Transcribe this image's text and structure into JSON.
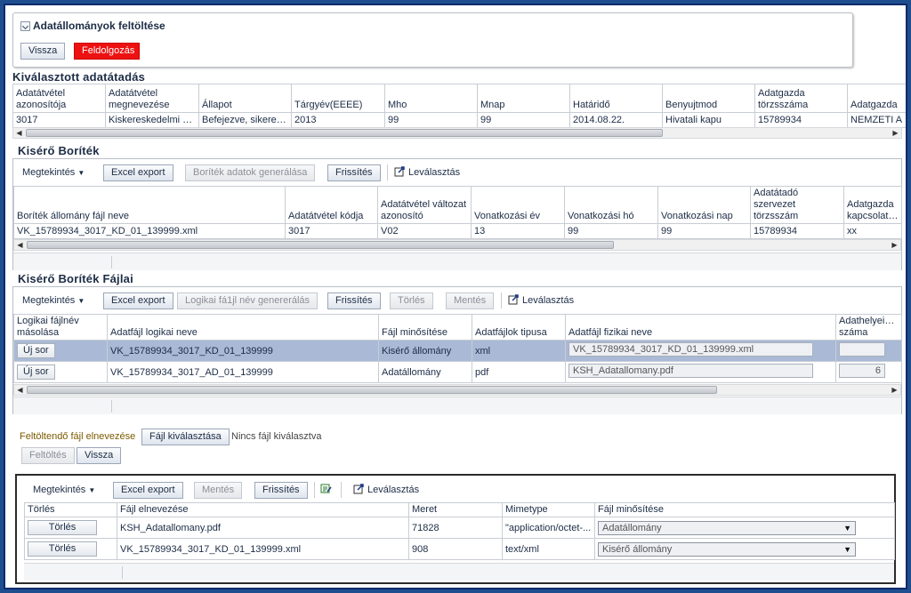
{
  "top": {
    "title": "Adatállományok feltöltése",
    "back_label": "Vissza",
    "process_label": "Feldolgozás"
  },
  "selected": {
    "title": "Kiválasztott adatátadás",
    "columns": [
      "Adatátvétel azonosítója",
      "Adatátvétel megnevezése",
      "Állapot",
      "Tárgyév(EEEE)",
      "Mho",
      "Mnap",
      "Határidő",
      "Benyujtmod",
      "Adatgazda törzsszáma",
      "Adatgazda"
    ],
    "rows": [
      [
        "3017",
        "Kiskereskedelmi e...",
        "Befejezve, sikeresen",
        "2013",
        "99",
        "99",
        "2014.08.22.",
        "Hivatali kapu",
        "15789934",
        "NEMZETI A"
      ]
    ]
  },
  "envelope": {
    "title": "Kisérő Boríték",
    "toolbar": {
      "view": "Megtekintés",
      "excel": "Excel export",
      "generate": "Boríték adatok generálása",
      "refresh": "Frissítés",
      "detach": "Leválasztás"
    },
    "columns": [
      "Boríték állomány fájl neve",
      "Adatátvétel kódja",
      "Adatátvétel változat azonosító",
      "Vonatkozási év",
      "Vonatkozási hó",
      "Vonatkozási nap",
      "Adatátadó szervezet törzsszám",
      "Adatgazda kapcsolattart"
    ],
    "rows": [
      [
        "VK_15789934_3017_KD_01_139999.xml",
        "3017",
        "V02",
        "13",
        "99",
        "99",
        "15789934",
        "xx"
      ]
    ]
  },
  "files": {
    "title": "Kisérő Boríték Fájlai",
    "toolbar": {
      "view": "Megtekintés",
      "excel": "Excel export",
      "generate": "Logikai fá1jl név genererálás",
      "refresh": "Frissítés",
      "delete": "Törlés",
      "save": "Mentés",
      "detach": "Leválasztás"
    },
    "columns": [
      "Logikai fájlnév másolása",
      "Adatfájl logikai neve",
      "Fájl minősítése",
      "Adatfájlok tipusa",
      "Adatfájl fizikai neve",
      "Adathelyeinek száma"
    ],
    "rows": [
      {
        "button": "Új sor",
        "logical": "VK_15789934_3017_KD_01_139999",
        "quality": "Kisérő állomány",
        "type": "xml",
        "physical": "VK_15789934_3017_KD_01_139999.xml",
        "count": ""
      },
      {
        "button": "Új sor",
        "logical": "VK_15789934_3017_AD_01_139999",
        "quality": "Adatállomány",
        "type": "pdf",
        "physical": "KSH_Adatallomany.pdf",
        "count": "6"
      }
    ]
  },
  "upload": {
    "label": "Feltöltendő fájl elnevezése",
    "choose": "Fájl kiválasztása",
    "no_file": "Nincs fájl kiválasztva",
    "upload_btn": "Feltöltés",
    "back_btn": "Vissza"
  },
  "uploaded": {
    "toolbar": {
      "view": "Megtekintés",
      "excel": "Excel export",
      "save": "Mentés",
      "refresh": "Frissítés",
      "detach": "Leválasztás"
    },
    "columns": [
      "Törlés",
      "Fájl elnevezése",
      "Meret",
      "Mimetype",
      "Fájl minősítése"
    ],
    "rows": [
      {
        "button": "Törlés",
        "name": "KSH_Adatallomany.pdf",
        "size": "71828",
        "mime": "\"application/octet-...",
        "quality": "Adatállomány"
      },
      {
        "button": "Törlés",
        "name": "VK_15789934_3017_KD_01_139999.xml",
        "size": "908",
        "mime": "text/xml",
        "quality": "Kisérő állomány"
      }
    ]
  },
  "colors": {
    "frame": "#1f4e8f",
    "selected_row": "#a9b9d6",
    "process_button": "#ee1111"
  }
}
